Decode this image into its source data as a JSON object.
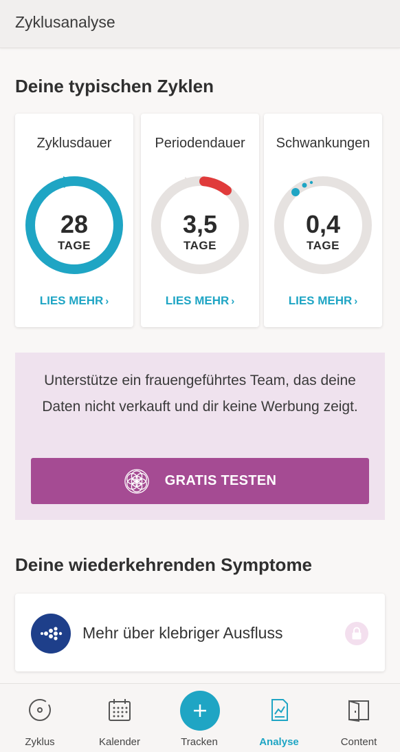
{
  "header": {
    "title": "Zyklusanalyse"
  },
  "cycles_section": {
    "title": "Deine typischen Zyklen",
    "cards": [
      {
        "title": "Zyklusdauer",
        "value": "28",
        "unit": "TAGE",
        "link": "LIES MEHR",
        "color": "#1fa5c4"
      },
      {
        "title": "Periodendauer",
        "value": "3,5",
        "unit": "TAGE",
        "link": "LIES MEHR",
        "color": "#e03b3b"
      },
      {
        "title": "Schwankungen",
        "value": "0,4",
        "unit": "TAGE",
        "link": "LIES MEHR",
        "color": "#1fa5c4"
      }
    ]
  },
  "promo": {
    "text": "Unterstütze ein frauengeführtes Team, das deine Daten nicht verkauft und dir keine Werbung zeigt.",
    "button_label": "GRATIS TESTEN",
    "button_icon": "flower-of-life-icon",
    "color": "#a54b93"
  },
  "symptoms_section": {
    "title": "Deine wiederkehrenden Symptome",
    "item_label": "Mehr über klebriger Ausfluss",
    "item_icon": "discharge-dots-icon",
    "locked": true
  },
  "tabbar": {
    "tabs": [
      {
        "label": "Zyklus",
        "icon": "cycle-icon",
        "active": false
      },
      {
        "label": "Kalender",
        "icon": "calendar-icon",
        "active": false
      },
      {
        "label": "Tracken",
        "icon": "plus-icon",
        "active": false
      },
      {
        "label": "Analyse",
        "icon": "analysis-icon",
        "active": true
      },
      {
        "label": "Content",
        "icon": "book-icon",
        "active": false
      }
    ],
    "accent": "#1fa5c4"
  }
}
